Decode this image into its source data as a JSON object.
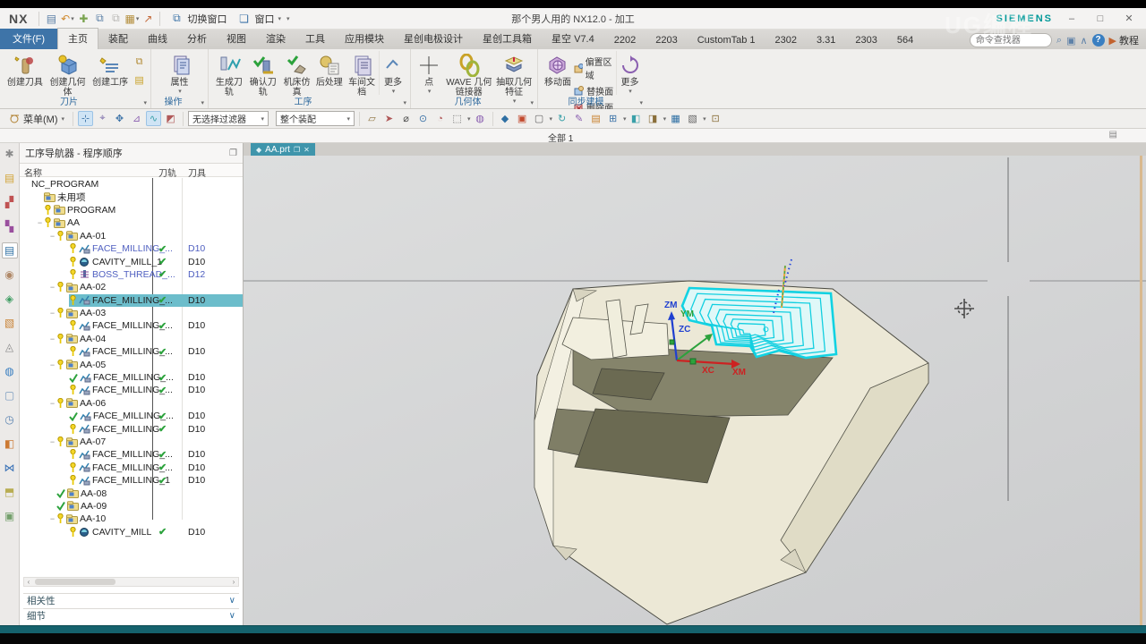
{
  "window": {
    "title": "那个男人用的 NX12.0 - 加工",
    "logo": "NX",
    "brand": "SIEMENS",
    "minimize": "–",
    "maximize": "□",
    "close": "✕"
  },
  "quick_access": {
    "switch_window": "切换窗口",
    "window": "窗口",
    "icons": [
      "save-icon",
      "undo-icon",
      "attach-icon",
      "copy-icon",
      "paste-icon",
      "clipboard-icon",
      "send-icon"
    ]
  },
  "watermark": "UG编程",
  "ribbon_tabs": [
    {
      "label": "文件(F)",
      "type": "file"
    },
    {
      "label": "主页",
      "type": "active"
    },
    {
      "label": "装配"
    },
    {
      "label": "曲线"
    },
    {
      "label": "分析"
    },
    {
      "label": "视图"
    },
    {
      "label": "渲染"
    },
    {
      "label": "工具"
    },
    {
      "label": "应用模块"
    },
    {
      "label": "星创电极设计"
    },
    {
      "label": "星创工具箱"
    },
    {
      "label": "星空 V7.4"
    },
    {
      "label": "2202"
    },
    {
      "label": "2203"
    },
    {
      "label": "CustomTab 1"
    },
    {
      "label": "2302"
    },
    {
      "label": "3.31"
    },
    {
      "label": "2303"
    },
    {
      "label": "564"
    }
  ],
  "command_finder": {
    "placeholder": "命令查找器"
  },
  "tabrow_right": {
    "tutorial": "教程",
    "help": "?"
  },
  "ribbon": {
    "groups": [
      {
        "label": "刀片",
        "buttons": [
          {
            "label": "创建刀具"
          },
          {
            "label": "创建几何体"
          },
          {
            "label": "创建工序"
          }
        ]
      },
      {
        "label": "操作",
        "buttons": [
          {
            "label": "属性"
          }
        ]
      },
      {
        "label": "工序",
        "buttons": [
          {
            "label": "生成刀轨"
          },
          {
            "label": "确认刀轨"
          },
          {
            "label": "机床仿真"
          },
          {
            "label": "后处理"
          },
          {
            "label": "车间文档"
          },
          {
            "label": "更多"
          }
        ]
      },
      {
        "label": "几何体",
        "buttons": [
          {
            "label": "点"
          },
          {
            "label": "WAVE 几何链接器"
          },
          {
            "label": "抽取几何特征"
          }
        ]
      },
      {
        "label": "同步建模",
        "buttons": [
          {
            "label": "移动面"
          },
          {
            "label": "更多"
          }
        ],
        "small_buttons": [
          {
            "label": "偏置区域"
          },
          {
            "label": "替换面"
          },
          {
            "label": "删除面"
          }
        ]
      }
    ]
  },
  "toolbar": {
    "menu_label": "菜单(M)",
    "filter_value": "无选择过滤器",
    "scope_value": "整个装配",
    "select_icons": [
      "select-highlight-icon",
      "select-group-icon",
      "select-point-icon",
      "select-component-icon",
      "snap-curve-icon",
      "snap-face-icon"
    ],
    "right_icons": [
      "datum-plane-icon",
      "move-object-icon",
      "measure-icon",
      "circle-snap-icon",
      "arc-center-icon",
      "rect-select-icon",
      "shaded-view-icon",
      "solid-view-icon",
      "window-zoom-icon",
      "fit-view-icon",
      "refresh-icon",
      "brush-icon",
      "layer-icon",
      "grid-icon",
      "render-style-icon",
      "object-display-icon",
      "view-orient-icon",
      "pane-icon",
      "plane-grid-icon"
    ]
  },
  "view_bar": {
    "label": "全部 1",
    "icon": "list-icon"
  },
  "sidebar": {
    "icons": [
      {
        "name": "gear-icon"
      },
      {
        "name": "assembly-navigator-icon"
      },
      {
        "name": "constraint-navigator-icon"
      },
      {
        "name": "part-navigator-icon"
      },
      {
        "name": "operation-navigator-icon",
        "selected": true
      },
      {
        "name": "machine-tool-navigator-icon"
      },
      {
        "name": "reuse-library-icon"
      },
      {
        "name": "visual-reports-icon"
      },
      {
        "name": "quick-access-icon"
      },
      {
        "name": "web-browser-icon"
      },
      {
        "name": "new-file-icon"
      },
      {
        "name": "history-icon"
      },
      {
        "name": "palette-icon"
      },
      {
        "name": "process-studio-icon"
      },
      {
        "name": "roles-icon"
      },
      {
        "name": "system-scenes-icon"
      }
    ]
  },
  "navigator": {
    "title": "工序导航器 - 程序顺序",
    "columns": [
      "名称",
      "刀轨",
      "刀具"
    ],
    "rows": [
      {
        "label": "NC_PROGRAM",
        "level": 0,
        "icon": "none",
        "prefix": "none"
      },
      {
        "label": "未用项",
        "level": 1,
        "icon": "folder",
        "prefix": "none"
      },
      {
        "label": "PROGRAM",
        "level": 1,
        "icon": "folder",
        "prefix": "key"
      },
      {
        "label": "AA",
        "level": 1,
        "icon": "folder",
        "prefix": "key",
        "exp": "minus"
      },
      {
        "label": "AA-01",
        "level": 2,
        "icon": "folder",
        "prefix": "key",
        "exp": "minus"
      },
      {
        "label": "FACE_MILLING_...",
        "level": 3,
        "icon": "mill",
        "prefix": "key",
        "color": "blue",
        "path": "check",
        "tool": "D10",
        "toolColor": "blue"
      },
      {
        "label": "CAVITY_MILL_1",
        "level": 3,
        "icon": "cavity",
        "prefix": "key",
        "path": "check",
        "tool": "D10"
      },
      {
        "label": "BOSS_THREAD_...",
        "level": 3,
        "icon": "thread",
        "prefix": "key",
        "color": "blue",
        "path": "check",
        "tool": "D12",
        "toolColor": "blue"
      },
      {
        "label": "AA-02",
        "level": 2,
        "icon": "folder",
        "prefix": "key",
        "exp": "minus"
      },
      {
        "label": "FACE_MILLING_...",
        "level": 3,
        "icon": "mill",
        "prefix": "key",
        "selected": true,
        "path": "check",
        "tool": "D10"
      },
      {
        "label": "AA-03",
        "level": 2,
        "icon": "folder",
        "prefix": "key",
        "exp": "minus"
      },
      {
        "label": "FACE_MILLING_...",
        "level": 3,
        "icon": "mill",
        "prefix": "key",
        "path": "check",
        "tool": "D10"
      },
      {
        "label": "AA-04",
        "level": 2,
        "icon": "folder",
        "prefix": "key",
        "exp": "minus"
      },
      {
        "label": "FACE_MILLING_...",
        "level": 3,
        "icon": "mill",
        "prefix": "key",
        "path": "check",
        "tool": "D10"
      },
      {
        "label": "AA-05",
        "level": 2,
        "icon": "folder",
        "prefix": "key",
        "exp": "minus"
      },
      {
        "label": "FACE_MILLING_...",
        "level": 3,
        "icon": "mill",
        "prefix": "check",
        "path": "check",
        "tool": "D10"
      },
      {
        "label": "FACE_MILLING_...",
        "level": 3,
        "icon": "mill",
        "prefix": "key",
        "path": "check",
        "tool": "D10"
      },
      {
        "label": "AA-06",
        "level": 2,
        "icon": "folder",
        "prefix": "key",
        "exp": "minus"
      },
      {
        "label": "FACE_MILLING_...",
        "level": 3,
        "icon": "mill",
        "prefix": "check",
        "path": "check",
        "tool": "D10"
      },
      {
        "label": "FACE_MILLING",
        "level": 3,
        "icon": "mill",
        "prefix": "key",
        "path": "check",
        "tool": "D10"
      },
      {
        "label": "AA-07",
        "level": 2,
        "icon": "folder",
        "prefix": "key",
        "exp": "minus"
      },
      {
        "label": "FACE_MILLING_...",
        "level": 3,
        "icon": "mill",
        "prefix": "key",
        "path": "check",
        "tool": "D10"
      },
      {
        "label": "FACE_MILLING_...",
        "level": 3,
        "icon": "mill",
        "prefix": "key",
        "path": "check",
        "tool": "D10"
      },
      {
        "label": "FACE_MILLING_1",
        "level": 3,
        "icon": "mill",
        "prefix": "key",
        "path": "check",
        "tool": "D10"
      },
      {
        "label": "AA-08",
        "level": 2,
        "icon": "folder",
        "prefix": "check"
      },
      {
        "label": "AA-09",
        "level": 2,
        "icon": "folder",
        "prefix": "check"
      },
      {
        "label": "AA-10",
        "level": 2,
        "icon": "folder",
        "prefix": "key",
        "exp": "minus"
      },
      {
        "label": "CAVITY_MILL",
        "level": 3,
        "icon": "cavity",
        "prefix": "key",
        "path": "check",
        "tool": "D10"
      }
    ],
    "fold_panels": [
      "相关性",
      "细节"
    ]
  },
  "viewport": {
    "tab": "AA.prt",
    "axis_labels": {
      "zm": "ZM",
      "ym": "YM",
      "zc": "ZC",
      "xc": "XC",
      "xm": "XM"
    }
  }
}
